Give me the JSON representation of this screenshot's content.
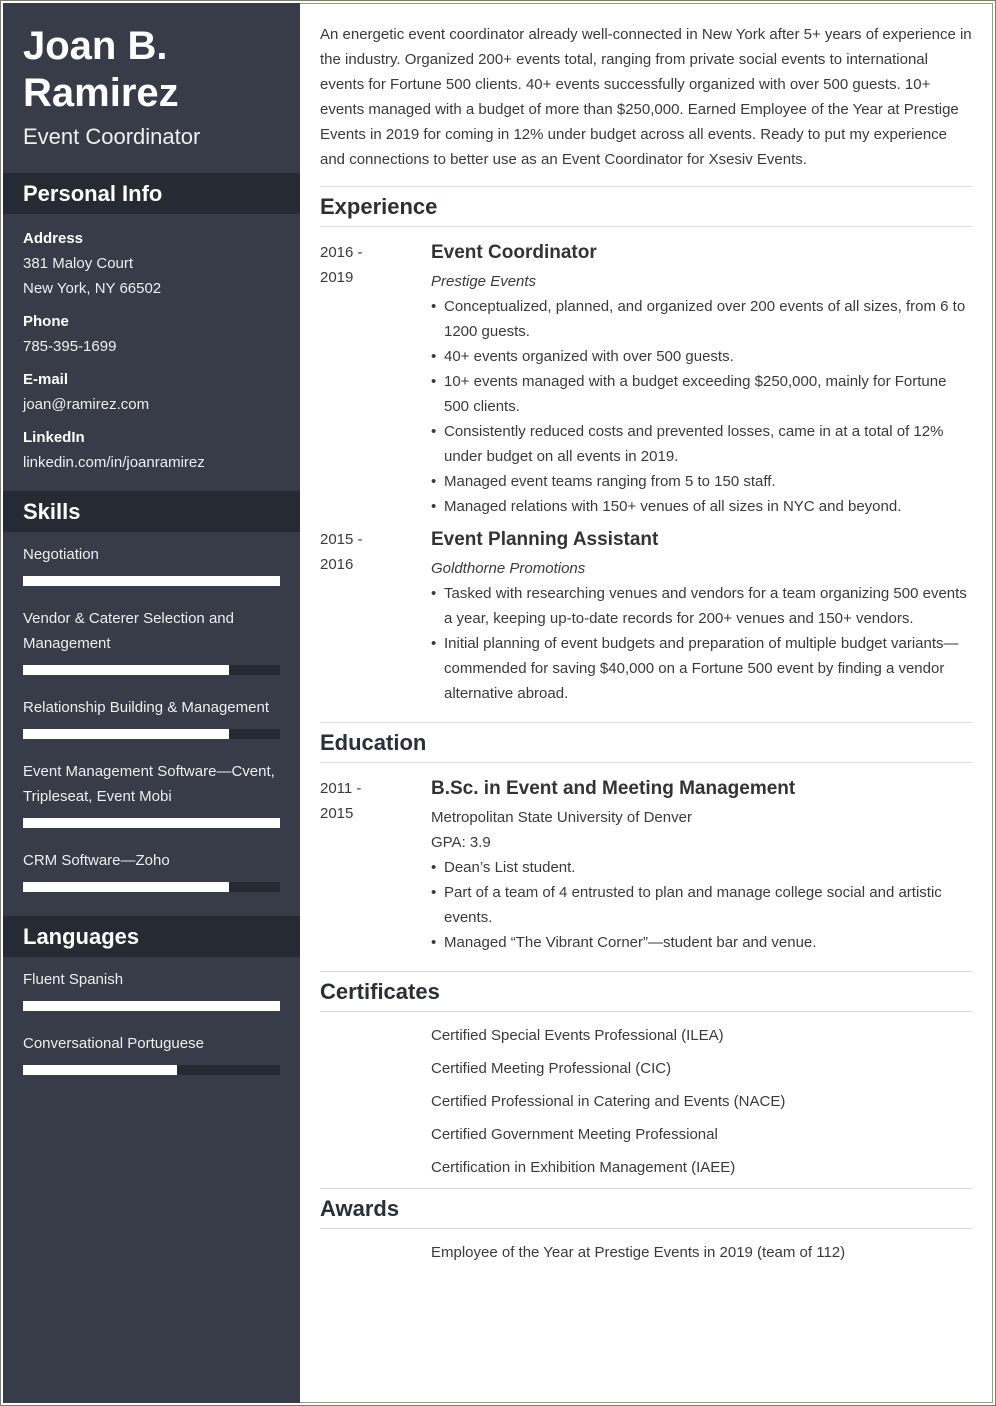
{
  "header": {
    "name_line1": "Joan B.",
    "name_line2": "Ramirez",
    "job_title": "Event Coordinator"
  },
  "colors": {
    "sidebar_bg": "#373c48",
    "sidebar_header_bg": "#252a33",
    "bar_fill": "#ffffff",
    "text_main": "#3a3a3a"
  },
  "personal_info": {
    "section_title": "Personal Info",
    "items": [
      {
        "label": "Address",
        "lines": [
          "381 Maloy Court",
          "New York, NY 66502"
        ]
      },
      {
        "label": "Phone",
        "lines": [
          "785-395-1699"
        ]
      },
      {
        "label": "E-mail",
        "lines": [
          "joan@ramirez.com"
        ]
      },
      {
        "label": "LinkedIn",
        "lines": [
          "linkedin.com/in/joanramirez"
        ]
      }
    ]
  },
  "skills": {
    "section_title": "Skills",
    "items": [
      {
        "name": "Negotiation",
        "level": 1.0
      },
      {
        "name": "Vendor & Caterer Selection and Management",
        "level": 0.8
      },
      {
        "name": "Relationship Building & Management",
        "level": 0.8
      },
      {
        "name": "Event Management Software—Cvent, Tripleseat, Event Mobi",
        "level": 1.0
      },
      {
        "name": "CRM Software—Zoho",
        "level": 0.8
      }
    ]
  },
  "languages": {
    "section_title": "Languages",
    "items": [
      {
        "name": "Fluent Spanish",
        "level": 1.0
      },
      {
        "name": "Conversational Portuguese",
        "level": 0.6
      }
    ]
  },
  "summary": "An energetic event coordinator already well-connected in New York after 5+ years of experience in the industry. Organized 200+ events total, ranging from private social events to international events for Fortune 500 clients. 40+ events successfully organized with over 500 guests. 10+ events managed with a budget of more than $250,000. Earned Employee of the Year at Prestige Events in 2019 for coming in 12% under budget across all events. Ready to put my experience and connections to better use as an Event Coordinator for Xsesiv Events.",
  "experience": {
    "section_title": "Experience",
    "entries": [
      {
        "date_start": "2016 -",
        "date_end": "2019",
        "title": "Event Coordinator",
        "company": "Prestige Events",
        "bullets": [
          "Conceptualized, planned, and organized over 200 events of all sizes, from 6 to 1200 guests.",
          "40+ events organized with over 500 guests.",
          "10+ events managed with a budget exceeding $250,000, mainly for Fortune 500 clients.",
          "Consistently reduced costs and prevented losses, came in at a total of 12% under budget on all events in 2019.",
          "Managed event teams ranging from 5 to 150 staff.",
          "Managed relations with 150+ venues of all sizes in NYC and beyond."
        ]
      },
      {
        "date_start": "2015 -",
        "date_end": "2016",
        "title": "Event Planning Assistant",
        "company": "Goldthorne Promotions",
        "bullets": [
          "Tasked with researching venues and vendors for a team organizing 500 events a year, keeping up-to-date records for 200+ venues and 150+ vendors.",
          "Initial planning of event budgets and preparation of multiple budget variants—commended for saving $40,000 on a Fortune 500 event by finding a vendor alternative abroad."
        ]
      }
    ]
  },
  "education": {
    "section_title": "Education",
    "entries": [
      {
        "date_start": "2011 -",
        "date_end": "2015",
        "title": "B.Sc. in Event and Meeting Management",
        "school": "Metropolitan State University of Denver",
        "gpa": "GPA: 3.9",
        "bullets": [
          "Dean’s List student.",
          "Part of a team of 4 entrusted to plan and manage college social and artistic events.",
          "Managed “The Vibrant Corner”—student bar and venue."
        ]
      }
    ]
  },
  "certificates": {
    "section_title": "Certificates",
    "items": [
      "Certified Special Events Professional (ILEA)",
      "Certified Meeting Professional (CIC)",
      "Certified Professional in Catering and Events (NACE)",
      "Certified Government Meeting Professional",
      "Certification in Exhibition Management (IAEE)"
    ]
  },
  "awards": {
    "section_title": "Awards",
    "items": [
      "Employee of the Year at Prestige Events in 2019 (team of 112)"
    ]
  }
}
